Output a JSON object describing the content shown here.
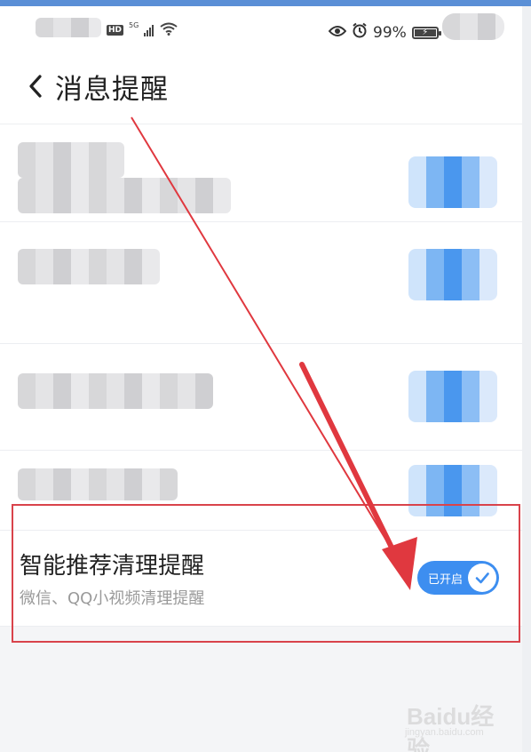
{
  "status_bar": {
    "battery_text": "99%",
    "network_label": "5G",
    "hd_label": "HD"
  },
  "header": {
    "title": "消息提醒"
  },
  "smart_cleanup": {
    "title": "智能推荐清理提醒",
    "subtitle": "微信、QQ小视频清理提醒",
    "toggle_label": "已开启",
    "enabled": true
  },
  "watermark": {
    "brand": "Baidu经验",
    "url": "jingyan.baidu.com"
  },
  "colors": {
    "accent": "#3d8ef0",
    "highlight_frame": "#d9434b",
    "arrow": "#e0383f"
  },
  "icons": {
    "back": "chevron-left-icon",
    "toggle_check": "check-icon",
    "eye": "eye-icon",
    "alarm": "alarm-icon",
    "wifi": "wifi-icon",
    "signal": "signal-icon",
    "battery": "battery-icon"
  }
}
